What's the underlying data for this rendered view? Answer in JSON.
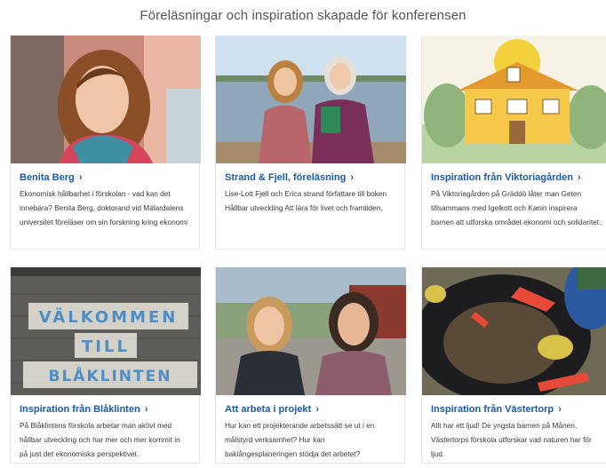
{
  "section": {
    "heading": "Föreläsningar och inspiration skapade för konferensen"
  },
  "cards": [
    {
      "title": "Benita Berg",
      "chevron": "›",
      "description": "Ekonomisk hållbarhet i förskolan - vad kan det innebära? Benita Berg, doktorand vid Mälardalens universitet  föreläser om sin forskning kring ekonomi"
    },
    {
      "title": "Strand & Fjell, föreläsning",
      "chevron": "›",
      "description": "Lise-Lott Fjell och Erica strand författare till boken Hållbar utveckling Att lära för livet och framtiden."
    },
    {
      "title": "Inspiration från Viktoriagården",
      "chevron": "›",
      "description": "På Viktoriagården på Gräddö låter man Geten tillsammans med Igelkott och Kanin inspirera barnen att utforska området ekonomi och solidaritet."
    },
    {
      "title": "Inspiration från Blåklinten",
      "chevron": "›",
      "description": "På Blåklintens förskola arbetar man aktivt med hållbar utveckling och har mer och mer kommit in på just det ekonomiska perspektivet."
    },
    {
      "title": "Att arbeta i projekt",
      "chevron": "›",
      "description": "Hur kan ett projekterande arbetssätt se ut i en målstyrd verksamhet? Hur kan baklångesplaneringen stödja det arbetet?"
    },
    {
      "title": "Inspiration från Västertorp",
      "chevron": "›",
      "description": "Allt har ett ljud! De yngsta barnen på Månen, Västertorps förskola utforskar vad naturen har för ljud."
    }
  ],
  "sign": {
    "line1": "VÄLKOMMEN",
    "line2": "TILL",
    "line3": "BLÅKLINTEN"
  }
}
